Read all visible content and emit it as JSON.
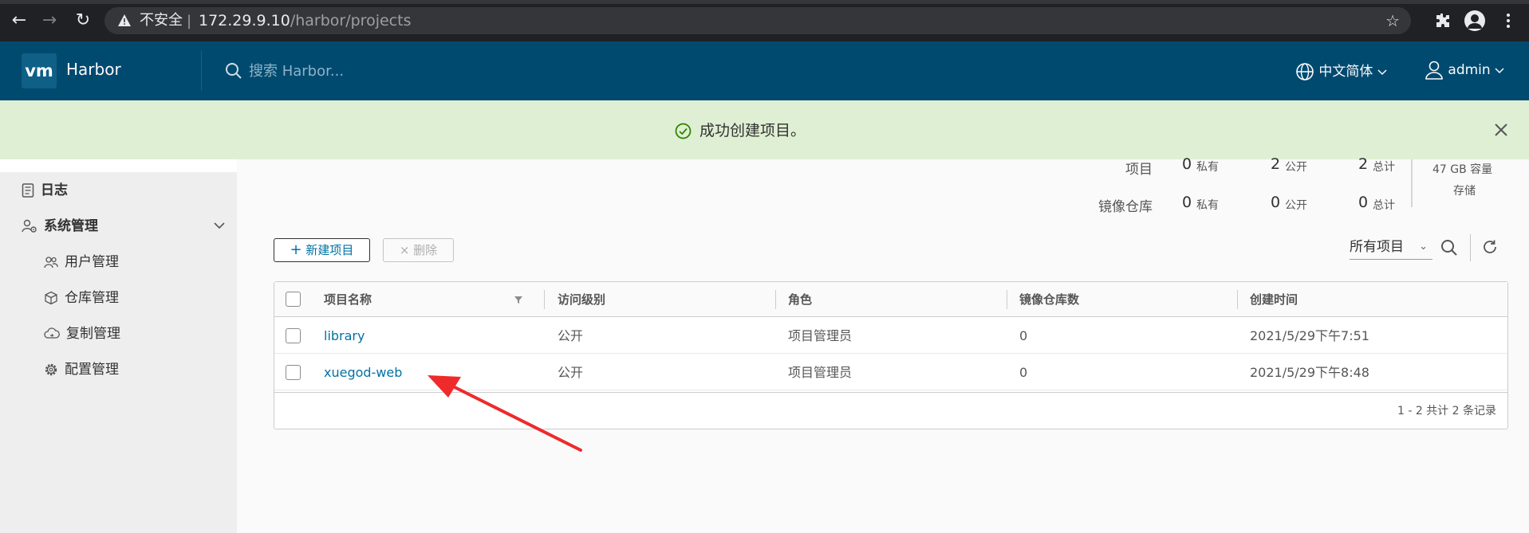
{
  "browser": {
    "insecure_label": "不安全",
    "separator": "|",
    "url_host": "172.29.9.10",
    "url_path": "/harbor/projects"
  },
  "header": {
    "logo_text": "vm",
    "brand": "Harbor",
    "search_placeholder": "搜索 Harbor...",
    "language": "中文简体",
    "user": "admin",
    "bg_color": "#004a70"
  },
  "toast": {
    "message": "成功创建项目。",
    "bg_color": "#dfefd3",
    "icon": "check-circle-icon"
  },
  "sidebar": {
    "items": [
      {
        "label": "日志",
        "icon": "log-icon"
      },
      {
        "label": "系统管理",
        "icon": "system-admin-icon"
      }
    ],
    "sub_items": [
      {
        "label": "用户管理",
        "icon": "users-icon"
      },
      {
        "label": "仓库管理",
        "icon": "registry-icon"
      },
      {
        "label": "复制管理",
        "icon": "replication-icon"
      },
      {
        "label": "配置管理",
        "icon": "settings-icon"
      }
    ]
  },
  "stats": {
    "project_label": "项目",
    "repo_label": "镜像仓库",
    "private_label": "私有",
    "public_label": "公开",
    "total_label": "总计",
    "projects": {
      "private": "0",
      "public": "2",
      "total": "2"
    },
    "repos": {
      "private": "0",
      "public": "0",
      "total": "0"
    },
    "storage_value": "47 GB 容量",
    "storage_label": "存储"
  },
  "toolbar": {
    "new_project": "新建项目",
    "delete": "删除",
    "filter_selected": "所有项目"
  },
  "grid": {
    "columns": [
      "项目名称",
      "访问级别",
      "角色",
      "镜像仓库数",
      "创建时间"
    ],
    "rows": [
      {
        "name": "library",
        "access": "公开",
        "role": "项目管理员",
        "repo_count": "0",
        "created": "2021/5/29下午7:51"
      },
      {
        "name": "xuegod-web",
        "access": "公开",
        "role": "项目管理员",
        "repo_count": "0",
        "created": "2021/5/29下午8:48"
      }
    ],
    "footer": "1 - 2 共计 2 条记录"
  },
  "annotation": {
    "arrow_color": "#ee2a2a"
  }
}
